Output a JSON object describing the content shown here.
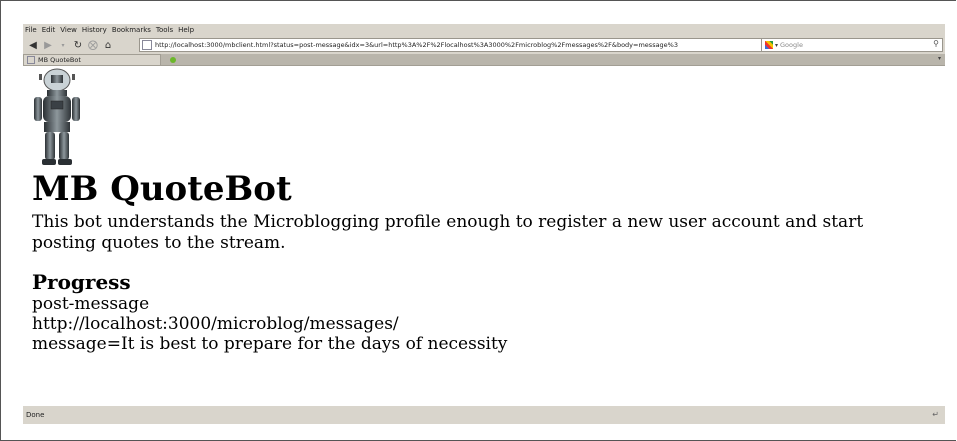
{
  "browser": {
    "menu": [
      "File",
      "Edit",
      "View",
      "History",
      "Bookmarks",
      "Tools",
      "Help"
    ],
    "url": "http://localhost:3000/mbclient.html?status=post-message&idx=3&url=http%3A%2F%2Flocalhost%3A3000%2Fmicroblog%2Fmessages%2F&body=message%3",
    "search_placeholder": "Google",
    "tab_title": "MB QuoteBot",
    "status": "Done"
  },
  "page": {
    "title": "MB QuoteBot",
    "description": "This bot understands the Microblogging profile enough to register a new user account and start posting quotes to the stream.",
    "progress_heading": "Progress",
    "progress_lines": [
      "post-message",
      "http://localhost:3000/microblog/messages/",
      "message=It is best to prepare for the days of necessity"
    ]
  }
}
